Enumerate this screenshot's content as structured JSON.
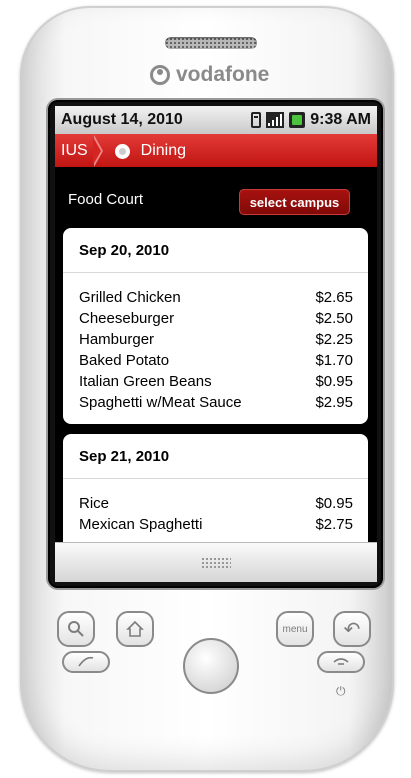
{
  "device": {
    "brand": "vodafone"
  },
  "statusbar": {
    "date": "August 14, 2010",
    "time": "9:38 AM",
    "icons": [
      "vibrate-icon",
      "signal-icon",
      "battery-icon"
    ]
  },
  "breadcrumb": {
    "home": "IUS",
    "current": "Dining",
    "icon": "plate-icon"
  },
  "header": {
    "title": "Food Court",
    "select_button": "select campus"
  },
  "menus": [
    {
      "date": "Sep 20, 2010",
      "items": [
        {
          "name": "Grilled Chicken",
          "price": "$2.65"
        },
        {
          "name": "Cheeseburger",
          "price": "$2.50"
        },
        {
          "name": "Hamburger",
          "price": "$2.25"
        },
        {
          "name": "Baked Potato",
          "price": "$1.70"
        },
        {
          "name": "Italian Green Beans",
          "price": "$0.95"
        },
        {
          "name": "Spaghetti w/Meat Sauce",
          "price": "$2.95"
        }
      ]
    },
    {
      "date": "Sep 21, 2010",
      "items": [
        {
          "name": "Rice",
          "price": "$0.95"
        },
        {
          "name": "Mexican Spaghetti",
          "price": "$2.75"
        }
      ]
    }
  ],
  "hardware": {
    "menu_label": "menu",
    "back_glyph": "↶",
    "power_glyph": "⏻"
  },
  "colors": {
    "accent_red": "#c01512",
    "select_button": "#a9120f"
  }
}
